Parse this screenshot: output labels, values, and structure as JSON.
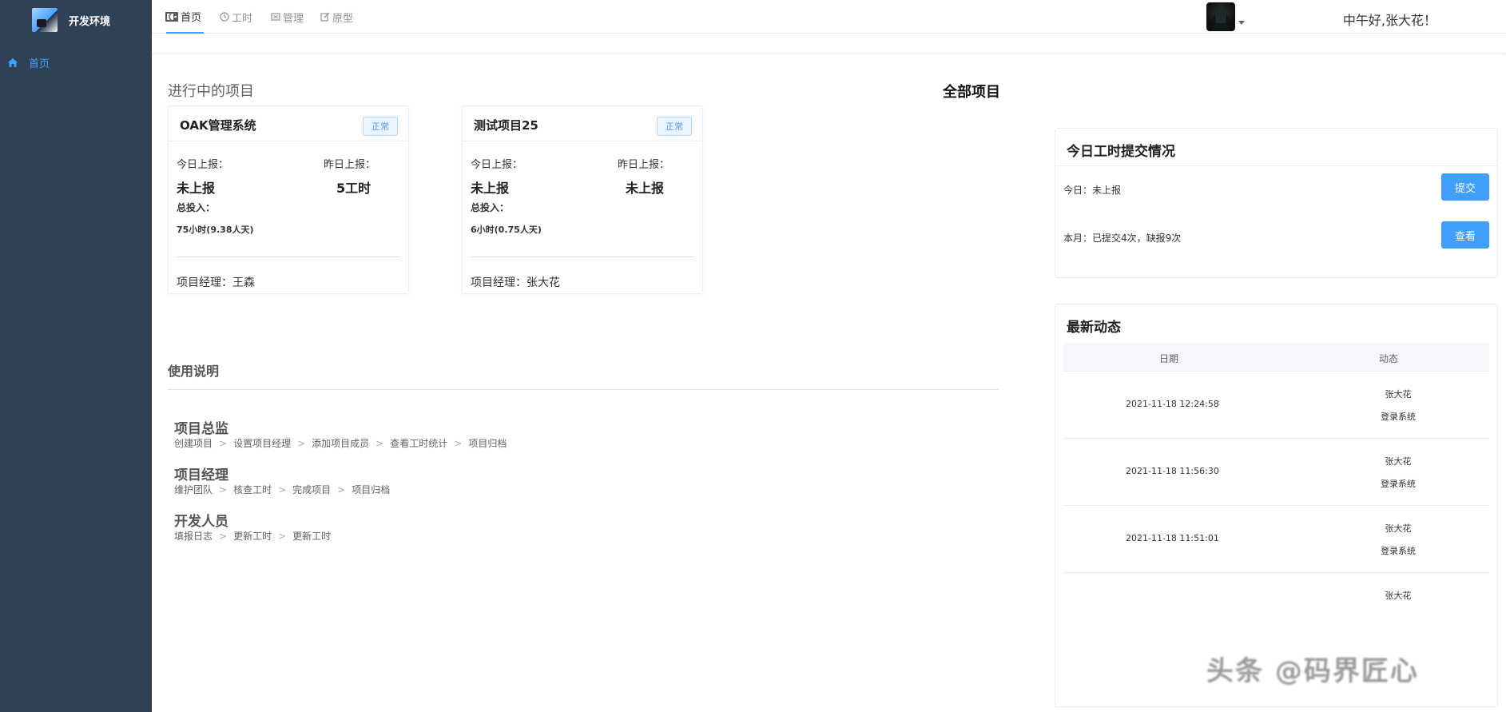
{
  "sidebar": {
    "title": "开发环境",
    "menu": [
      {
        "label": "首页",
        "icon": "home-icon",
        "active": true
      }
    ]
  },
  "topnav": {
    "tabs": [
      {
        "label": "首页",
        "icon": "dashboard-icon",
        "active": true
      },
      {
        "label": "工时",
        "icon": "clock-icon",
        "active": false
      },
      {
        "label": "管理",
        "icon": "manage-icon",
        "active": false
      },
      {
        "label": "原型",
        "icon": "edit-icon",
        "active": false
      }
    ],
    "greeting": "中午好,张大花！"
  },
  "main": {
    "in_progress_title": "进行中的项目",
    "all_projects_label": "全部项目",
    "projects": [
      {
        "name": "OAK管理系统",
        "status": "正常",
        "today_label": "今日上报：",
        "today_value": "未上报",
        "yesterday_label": "昨日上报：",
        "yesterday_value": "5工时",
        "total_label": "总投入：",
        "total_value": "75小时(9.38人天)",
        "manager": "项目经理：王森"
      },
      {
        "name": "测试项目25",
        "status": "正常",
        "today_label": "今日上报：",
        "today_value": "未上报",
        "yesterday_label": "昨日上报：",
        "yesterday_value": "未上报",
        "total_label": "总投入：",
        "total_value": "6小时(0.75人天)",
        "manager": "项目经理：张大花"
      }
    ],
    "usage": {
      "title": "使用说明",
      "roles": [
        {
          "name": "项目总监",
          "steps": [
            "创建项目",
            "设置项目经理",
            "添加项目成员",
            "查看工时统计",
            "项目归档"
          ]
        },
        {
          "name": "项目经理",
          "steps": [
            "维护团队",
            "核查工时",
            "完成项目",
            "项目归档"
          ]
        },
        {
          "name": "开发人员",
          "steps": [
            "填报日志",
            "更新工时",
            "更新工时"
          ]
        }
      ]
    }
  },
  "worklog_panel": {
    "title": "今日工时提交情况",
    "today_text": "今日：未上报",
    "submit_label": "提交",
    "month_text": "本月：已提交4次，缺报9次",
    "view_label": "查看"
  },
  "feed_panel": {
    "title": "最新动态",
    "col_date": "日期",
    "col_activity": "动态",
    "rows": [
      {
        "date": "2021-11-18 12:24:58",
        "user": "张大花",
        "action": "登录系统"
      },
      {
        "date": "2021-11-18 11:56:30",
        "user": "张大花",
        "action": "登录系统"
      },
      {
        "date": "2021-11-18 11:51:01",
        "user": "张大花",
        "action": "登录系统"
      },
      {
        "date": "",
        "user": "张大花",
        "action": ""
      }
    ]
  },
  "watermark": "头条 @码界匠心",
  "colors": {
    "sidebar_bg": "#304156",
    "accent": "#409eff"
  }
}
